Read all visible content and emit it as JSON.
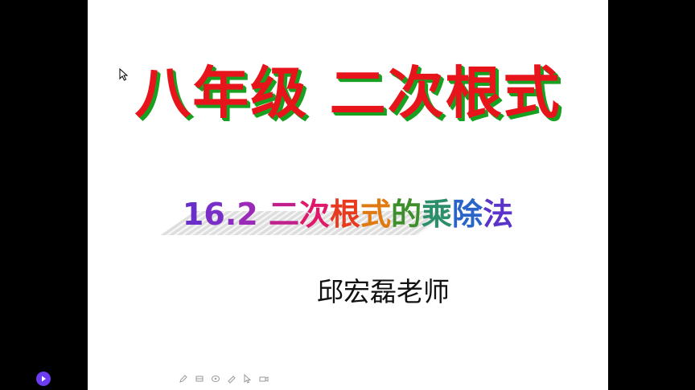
{
  "slide": {
    "title": "八年级 二次根式",
    "subtitle_chars": [
      "1",
      "6",
      ".",
      "2",
      " ",
      "二",
      "次",
      "根",
      "式",
      "的",
      "乘",
      "除",
      "法"
    ],
    "subtitle_colors": [
      "#6a2fc8",
      "#7a2ec8",
      "#8a2dc0",
      "#9b2ab8",
      "#a026a8",
      "#c01f8c",
      "#e0186a",
      "#e83a1e",
      "#e07a10",
      "#3c8f2a",
      "#2a8f6a",
      "#2a64c8",
      "#5a34c8"
    ],
    "teacher": "邱宏磊老师"
  },
  "toolbar": {
    "icons": [
      "pen-icon",
      "eraser-icon",
      "highlighter-icon",
      "lasso-icon",
      "pointer-icon",
      "camera-icon"
    ]
  },
  "player": {
    "icon": "play-icon",
    "accent": "#6b3cf0"
  }
}
